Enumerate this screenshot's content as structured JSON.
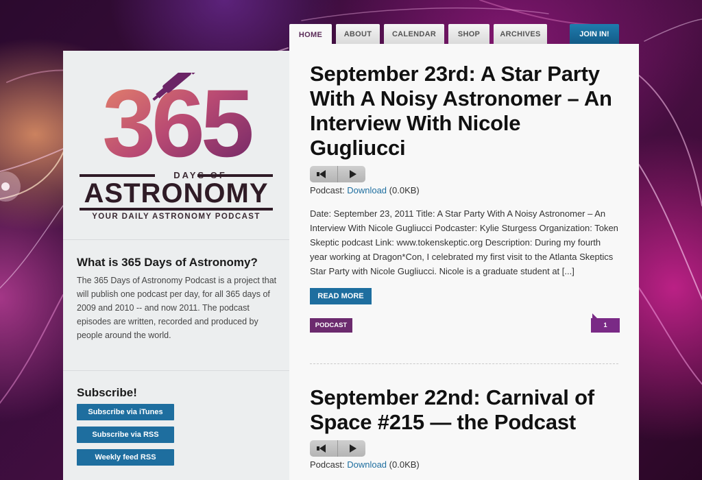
{
  "nav": {
    "tabs": [
      {
        "label": "HOME",
        "active": true
      },
      {
        "label": "ABOUT"
      },
      {
        "label": "CALENDAR"
      },
      {
        "label": "SHOP"
      },
      {
        "label": "ARCHIVES"
      }
    ],
    "join_label": "JOIN IN!"
  },
  "logo": {
    "number": "365",
    "days_of": "DAYS OF",
    "astronomy": "ASTRONOMY",
    "tagline": "YOUR DAILY ASTRONOMY PODCAST"
  },
  "sidebar": {
    "about_title": "What is 365 Days of Astronomy?",
    "about_text": "The 365 Days of Astronomy Podcast is a project that will publish one podcast per day, for all 365 days of 2009 and 2010 -- and now 2011. The podcast episodes are written, recorded and produced by people around the world.",
    "subscribe_title": "Subscribe!",
    "subscribe_buttons": [
      "Subscribe via iTunes",
      "Subscribe via RSS",
      "Weekly feed RSS"
    ]
  },
  "posts": [
    {
      "title": "September 23rd: A Star Party With A Noisy Astronomer – An Interview With Nicole Gugliucci",
      "podcast_label": "Podcast:",
      "download_label": "Download",
      "download_size": "(0.0KB)",
      "excerpt": "Date: September 23, 2011 Title: A Star Party With A Noisy Astronomer – An Interview With Nicole Gugliucci Podcaster: Kylie Sturgess Organization: Token Skeptic podcast Link: www.tokenskeptic.org Description: During my fourth year working at Dragon*Con, I celebrated my first visit to the Atlanta Skeptics Star Party with Nicole Gugliucci. Nicole is a graduate student at [...]",
      "read_more": "READ MORE",
      "category": "PODCAST",
      "comments": "1"
    },
    {
      "title": "September 22nd: Carnival of Space #215 — the Podcast",
      "podcast_label": "Podcast:",
      "download_label": "Download",
      "download_size": "(0.0KB)"
    }
  ],
  "colors": {
    "accent_blue": "#1e6e9f",
    "accent_purple": "#6c2a6e",
    "logo_number_gradient": [
      "#e27a5a",
      "#7a2a7a"
    ]
  }
}
